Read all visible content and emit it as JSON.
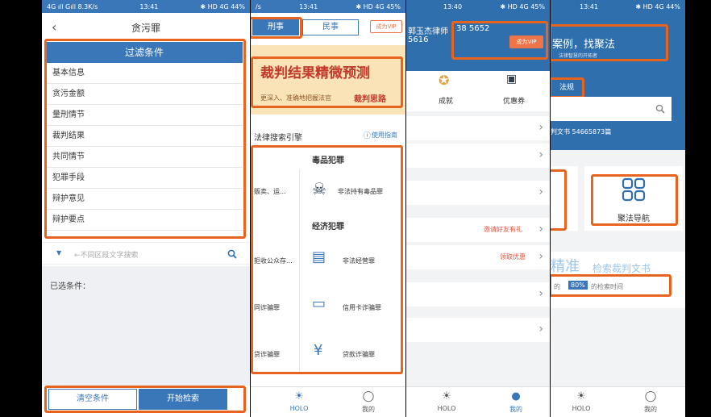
{
  "colors": {
    "accent": "#3a77b8",
    "highlight": "#e8641e",
    "vip": "#f0744a",
    "link_red": "#e8503a"
  },
  "p1": {
    "status_left": "4G ıll Gıll 8.3K/s",
    "time": "13:41",
    "status_right": "✱ HD 4G 44%",
    "title": "贪污罪",
    "filter_header": "过滤条件",
    "filters": [
      "基本信息",
      "贪污金额",
      "量刑情节",
      "裁判结果",
      "共同情节",
      "犯罪手段",
      "辩护意见",
      "辩护要点"
    ],
    "search_placeholder": "←不同区段文字搜索",
    "selected_label": "已选条件：",
    "clear_button": "清空条件",
    "search_button": "开始检索"
  },
  "p2": {
    "time": "13:41",
    "status_right": "✱ HD 4G 45%",
    "status_left": "/s",
    "tab_criminal": "刑事",
    "tab_civil": "民事",
    "vip_button": "成为VIP",
    "banner_title": "裁判结果精微预测",
    "banner_sub": "更深入、准确地把握法官",
    "banner_sub_bold": "裁判思路",
    "engine_title": "法律搜索引擎",
    "guide": "使用指南",
    "cat1": "毒品犯罪",
    "cat1_items": [
      "贩卖、运...",
      "非法持有毒品罪"
    ],
    "cat2": "经济犯罪",
    "cat2_items": [
      "拒收公众存...",
      "非法经营罪",
      "同诈骗罪",
      "信用卡诈骗罪",
      "贷诈骗罪",
      "贷款诈骗罪"
    ],
    "nav": [
      "HOLO",
      "我的"
    ]
  },
  "p3": {
    "time": "13:40",
    "status_right": "✱ HD 4G 45%",
    "lawyer": "郭玉杰律师",
    "phone": "38 5652",
    "id_partial": "5616",
    "vip_button": "成为VIP",
    "icon1": "成就",
    "icon2": "优惠券",
    "invite": "邀请好友有礼",
    "coupon": "领取优惠",
    "nav": [
      "HOLO",
      "我的"
    ]
  },
  "p4": {
    "time": "13:41",
    "status_right": "✱ HD 4G 44%",
    "slogan": "案例，找聚法",
    "slogan_sub": "法律智慧的开拓者",
    "tab_law": "法规",
    "doc_count": "判文书 54665873篇",
    "nav_button": "聚法导航",
    "precise": "精准",
    "precise_sub": "检索裁判文书",
    "pct": "80%",
    "pct_tail": "的检索时间",
    "pct_head": "的",
    "nav": [
      "HOLO",
      "我的"
    ]
  }
}
